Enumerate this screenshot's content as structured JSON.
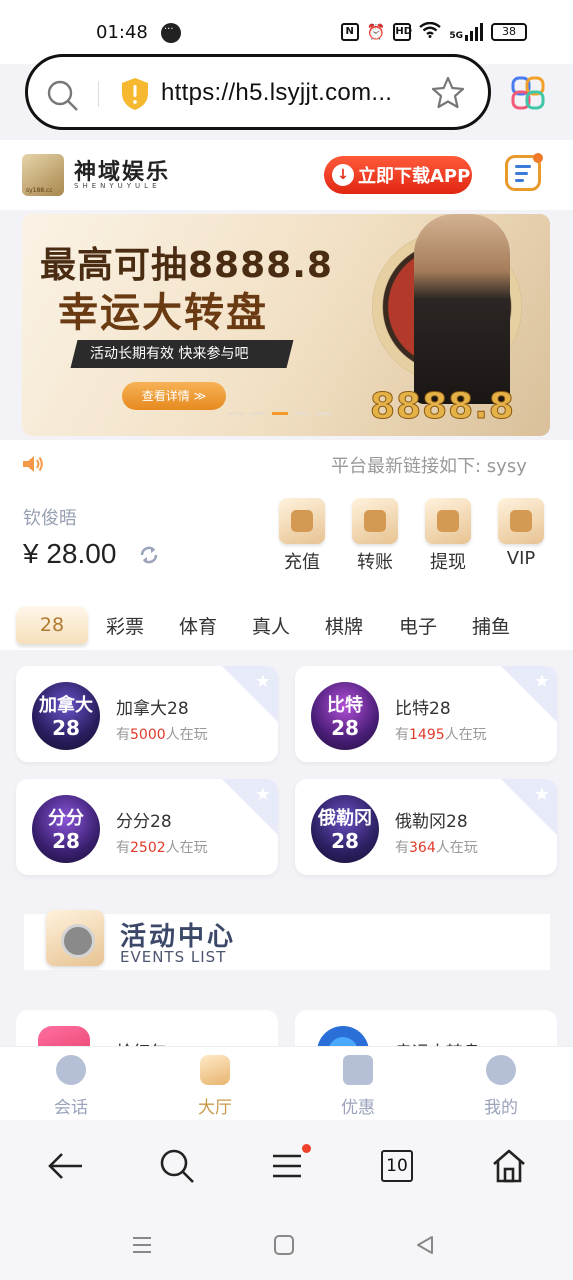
{
  "status_bar": {
    "time": "01:48",
    "net": "5G",
    "battery": "38"
  },
  "browser": {
    "url": "https://h5.lsyjjt.com..."
  },
  "site": {
    "logo_text": "神域娱乐",
    "logo_sub": "SHENYUYULE",
    "logo_badge": "sy188.cc",
    "download_label": "立即下载APP"
  },
  "banner": {
    "line1": "最高可抽8888.8",
    "line2": "幸运大转盘",
    "tagline": "活动长期有效 快来参与吧",
    "detail_button": "查看详情 ≫",
    "amount": "8888.8"
  },
  "notice": {
    "text": "平台最新链接如下:  sysy"
  },
  "wallet": {
    "username": "钦俊晤",
    "balance": "¥ 28.00",
    "actions": [
      {
        "label": "充值",
        "icon": "wallet-icon"
      },
      {
        "label": "转账",
        "icon": "transfer-icon"
      },
      {
        "label": "提现",
        "icon": "withdraw-icon"
      },
      {
        "label": "VIP",
        "icon": "vip-icon"
      }
    ]
  },
  "tabs": [
    "28",
    "彩票",
    "体育",
    "真人",
    "棋牌",
    "电子",
    "捕鱼"
  ],
  "games": [
    {
      "name": "加拿大28",
      "icon_top": "加拿大",
      "icon_bottom": "28",
      "prefix": "有",
      "count": "5000",
      "suffix": "人在玩"
    },
    {
      "name": "比特28",
      "icon_top": "比特",
      "icon_bottom": "28",
      "prefix": "有",
      "count": "1495",
      "suffix": "人在玩"
    },
    {
      "name": "分分28",
      "icon_top": "分分",
      "icon_bottom": "28",
      "prefix": "有",
      "count": "2502",
      "suffix": "人在玩"
    },
    {
      "name": "俄勒冈28",
      "icon_top": "俄勒冈",
      "icon_bottom": "28",
      "prefix": "有",
      "count": "364",
      "suffix": "人在玩"
    }
  ],
  "events": {
    "title": "活动中心",
    "subtitle": "EVENTS LIST",
    "items": [
      {
        "label": "抢红包"
      },
      {
        "label": "幸运大转盘"
      }
    ]
  },
  "app_nav": [
    {
      "label": "会话",
      "icon": "chat-icon"
    },
    {
      "label": "大厅",
      "icon": "lobby-icon"
    },
    {
      "label": "优惠",
      "icon": "promo-icon"
    },
    {
      "label": "我的",
      "icon": "profile-icon"
    }
  ],
  "browser_toolbar": {
    "tab_count": "10"
  },
  "colors": {
    "accent_red": "#e52f17",
    "gold": "#c8994c",
    "player_count": "#e03a2a",
    "nav_inactive": "#9aa3bb"
  }
}
